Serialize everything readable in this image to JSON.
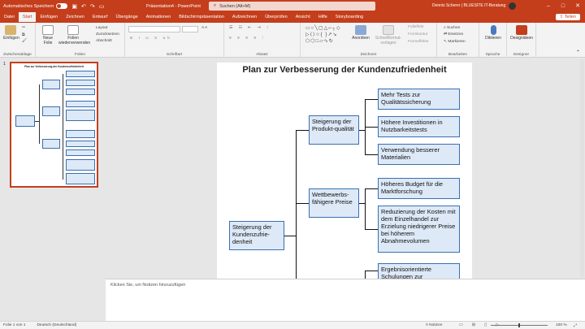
{
  "titlebar": {
    "autosave": "Automatisches Speichern",
    "doc": "Präsentation4 - PowerPoint",
    "search": "Suchen (Alt+M)",
    "user": "Dennis Scherer | BLUESITE IT-Beratung"
  },
  "tabs": [
    "Datei",
    "Start",
    "Einfügen",
    "Zeichnen",
    "Entwurf",
    "Übergänge",
    "Animationen",
    "Bildschirmpräsentation",
    "Aufzeichnen",
    "Überprüfen",
    "Ansicht",
    "Hilfe",
    "Storyboarding"
  ],
  "share": "Teilen",
  "ribbon": {
    "clipboard": {
      "paste": "Einfügen",
      "label": "Zwischenablage"
    },
    "slides": {
      "new": "Neue Folie",
      "reuse": "Folien wiederverwenden",
      "layout": "Layout",
      "reset": "Zurücksetzen",
      "section": "Abschnitt",
      "label": "Folien"
    },
    "font": {
      "label": "Schriftart"
    },
    "paragraph": {
      "label": "Absatz"
    },
    "drawing": {
      "arrange": "Anordnen",
      "quickstyles": "Schnellformat-vorlagen",
      "fill": "Fülleffekt",
      "outline": "Formkontur",
      "effects": "Formeffekte",
      "label": "Zeichnen"
    },
    "editing": {
      "find": "Suchen",
      "replace": "Ersetzen",
      "select": "Markieren",
      "label": "Bearbeiten"
    },
    "voice": {
      "dictate": "Diktieren",
      "label": "Sprache"
    },
    "designer": {
      "button": "Designideen",
      "label": "Designer"
    }
  },
  "slide_number": "1",
  "slide": {
    "title": "Plan zur Verbesserung der Kundenzufriedenheit",
    "root": "Steigerung der Kundenzufrie-denheit",
    "branches": [
      {
        "label": "Steigerung der Produkt-qualität",
        "leaves": [
          "Mehr Tests zur Qualitätssicherung",
          "Höhere Investitionen in Nutzbarkeitstests",
          "Verwendung besserer Materialien"
        ]
      },
      {
        "label": "Wettbewerbs-fähigere Preise",
        "leaves": [
          "Höheres Budget für die Marktforschung",
          "Reduzierung der Kosten mit dem Einzelhandel zur Erzielung niedrigerer Preise bei höherem Abnahmevolumen"
        ]
      },
      {
        "label": "",
        "leaves": [
          "Ergebnisorientierte Schulungen zur Verbesserung"
        ]
      }
    ]
  },
  "notes_placeholder": "Klicken Sie, um Notizen hinzuzufügen",
  "status": {
    "slide": "Folie 1 von 1",
    "language": "Deutsch (Deutschland)",
    "notes": "Notizen",
    "zoom": "100 %"
  }
}
